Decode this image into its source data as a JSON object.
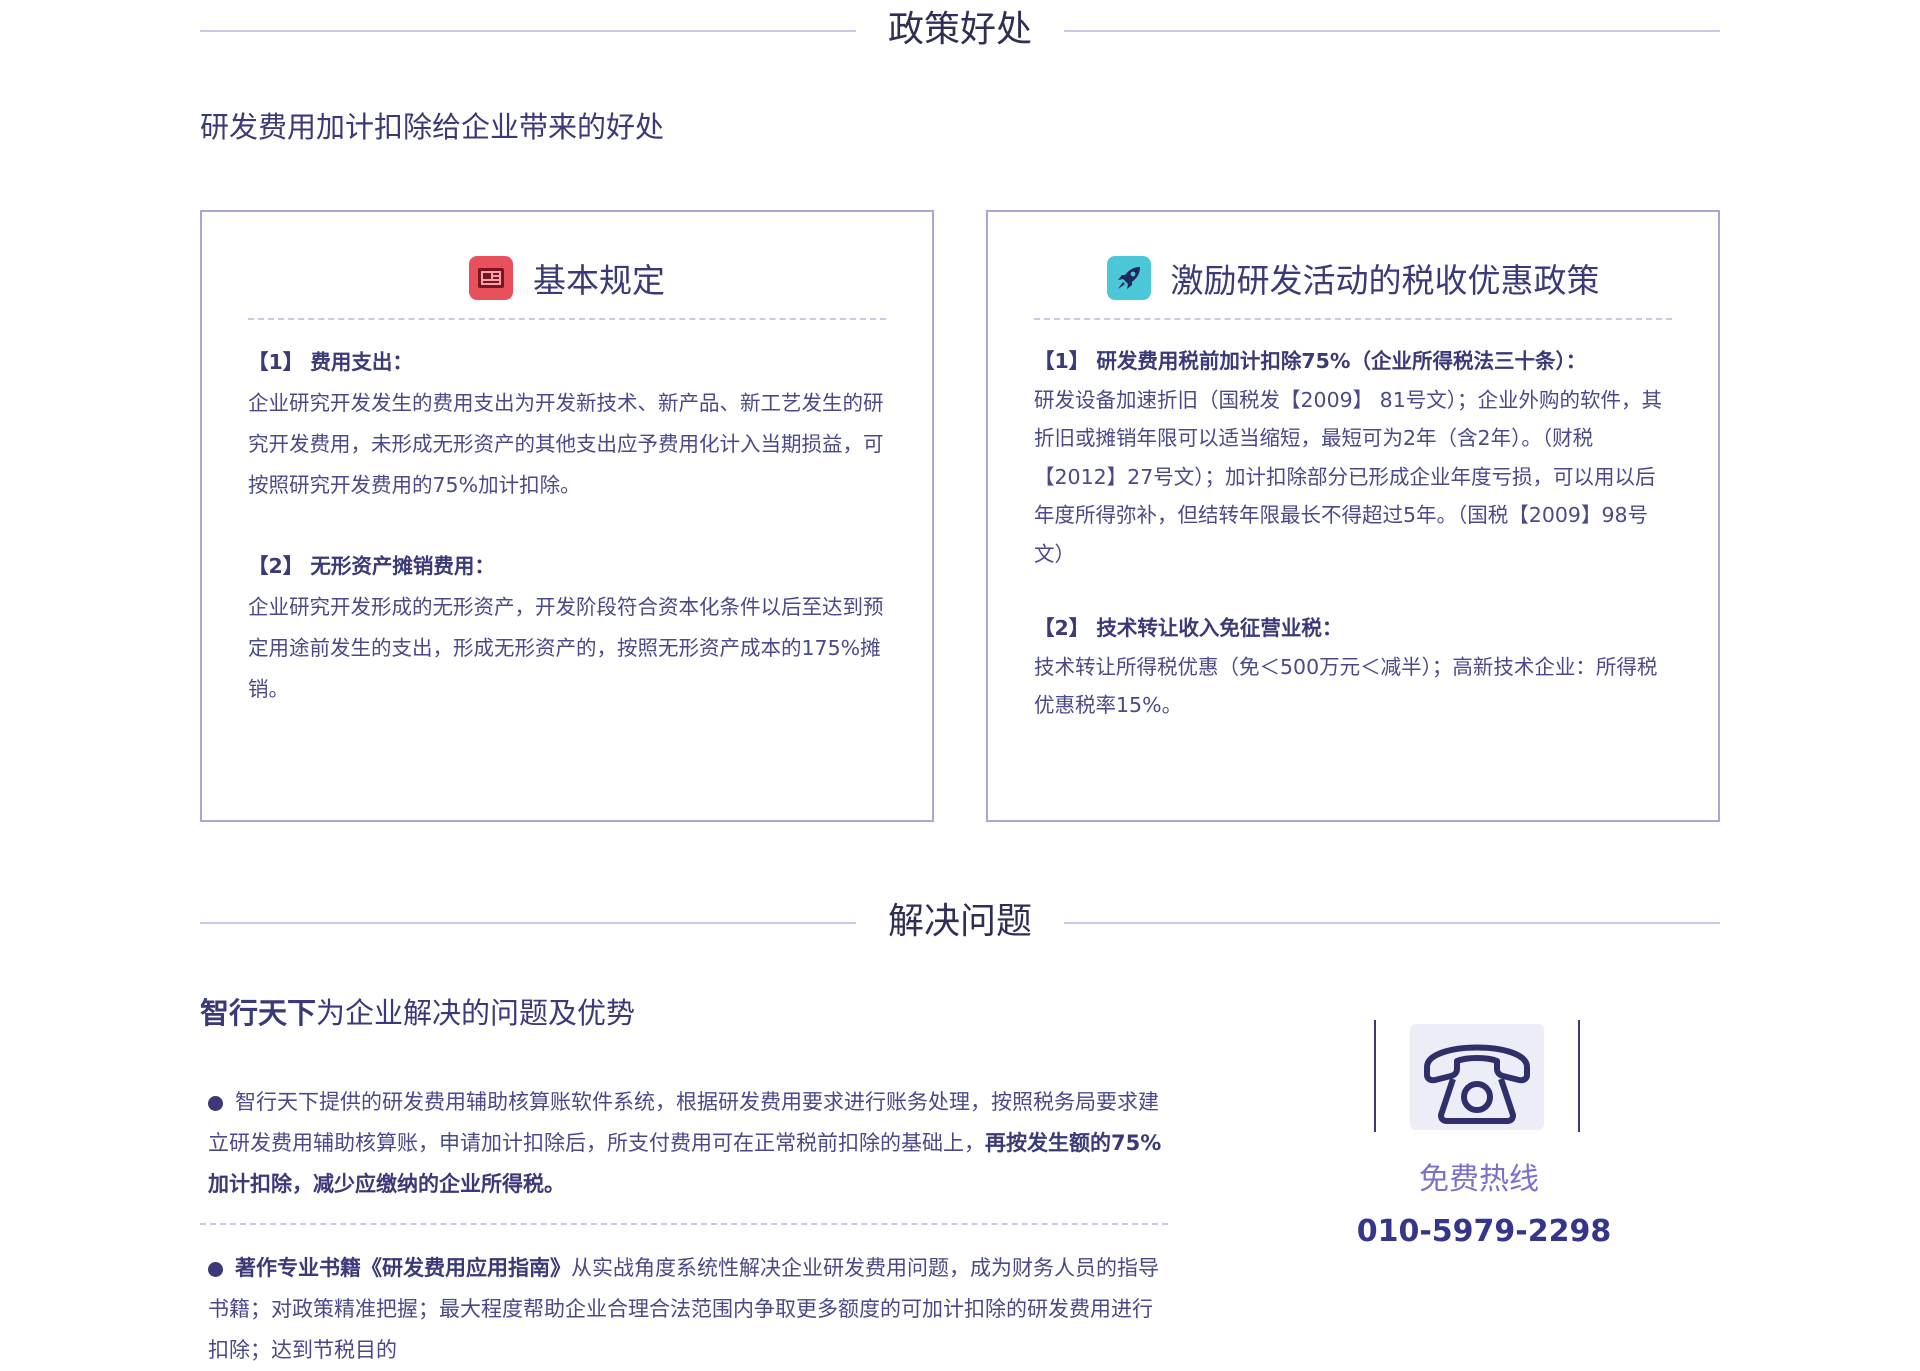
{
  "policy": {
    "section_title": "政策好处",
    "subtitle": "研发费用加计扣除给企业带来的好处",
    "cards": [
      {
        "title": "基本规定",
        "icon": "newspaper-icon",
        "items": [
          {
            "heading": "【1】 费用支出：",
            "text": "企业研究开发发生的费用支出为开发新技术、新产品、新工艺发生的研究开发费用，未形成无形资产的其他支出应予费用化计入当期损益，可按照研究开发费用的75%加计扣除。"
          },
          {
            "heading": "【2】 无形资产摊销费用：",
            "text": "企业研究开发形成的无形资产，开发阶段符合资本化条件以后至达到预定用途前发生的支出，形成无形资产的，按照无形资产成本的175%摊销。"
          }
        ]
      },
      {
        "title": "激励研发活动的税收优惠政策",
        "icon": "rocket-icon",
        "items": [
          {
            "heading": "【1】 研发费用税前加计扣除75%（企业所得税法三十条）：",
            "text": "研发设备加速折旧（国税发【2009】 81号文）；企业外购的软件，其折旧或摊销年限可以适当缩短，最短可为2年（含2年）。（财税【2012】27号文）；加计扣除部分已形成企业年度亏损，可以用以后年度所得弥补，但结转年限最长不得超过5年。（国税【2009】98号文）"
          },
          {
            "heading": "【2】 技术转让收入免征营业税：",
            "text": "技术转让所得税优惠（免＜500万元＜减半）；高新技术企业：所得税优惠税率15%。"
          }
        ]
      }
    ]
  },
  "solution": {
    "section_title": "解决问题",
    "title_bold": "智行天下",
    "title_rest": "为企业解决的问题及优势",
    "bullets": [
      {
        "lead": "",
        "text": "智行天下提供的研发费用辅助核算账软件系统，根据研发费用要求进行账务处理，按照税务局要求建立研发费用辅助核算账，申请加计扣除后，所支付费用可在正常税前扣除的基础上，",
        "bold": "再按发生额的75%加计扣除，减少应缴纳的企业所得税。"
      },
      {
        "lead": "著作专业书籍《研发费用应用指南》",
        "text": "从实战角度系统性解决企业研发费用问题，成为财务人员的指导书籍；对政策精准把握；最大程度帮助企业合理合法范围内争取更多额度的可加计扣除的研发费用进行扣除；达到节税目的",
        "bold": ""
      }
    ]
  },
  "hotline": {
    "icon": "telephone-icon",
    "label": "免费热线",
    "number": "010-5979-2298"
  },
  "colors": {
    "primary": "#3a3a78",
    "accent": "#7a72c8",
    "border": "#a9a9d8",
    "icon_red": "#e8505b",
    "icon_teal": "#4cc7d8"
  }
}
